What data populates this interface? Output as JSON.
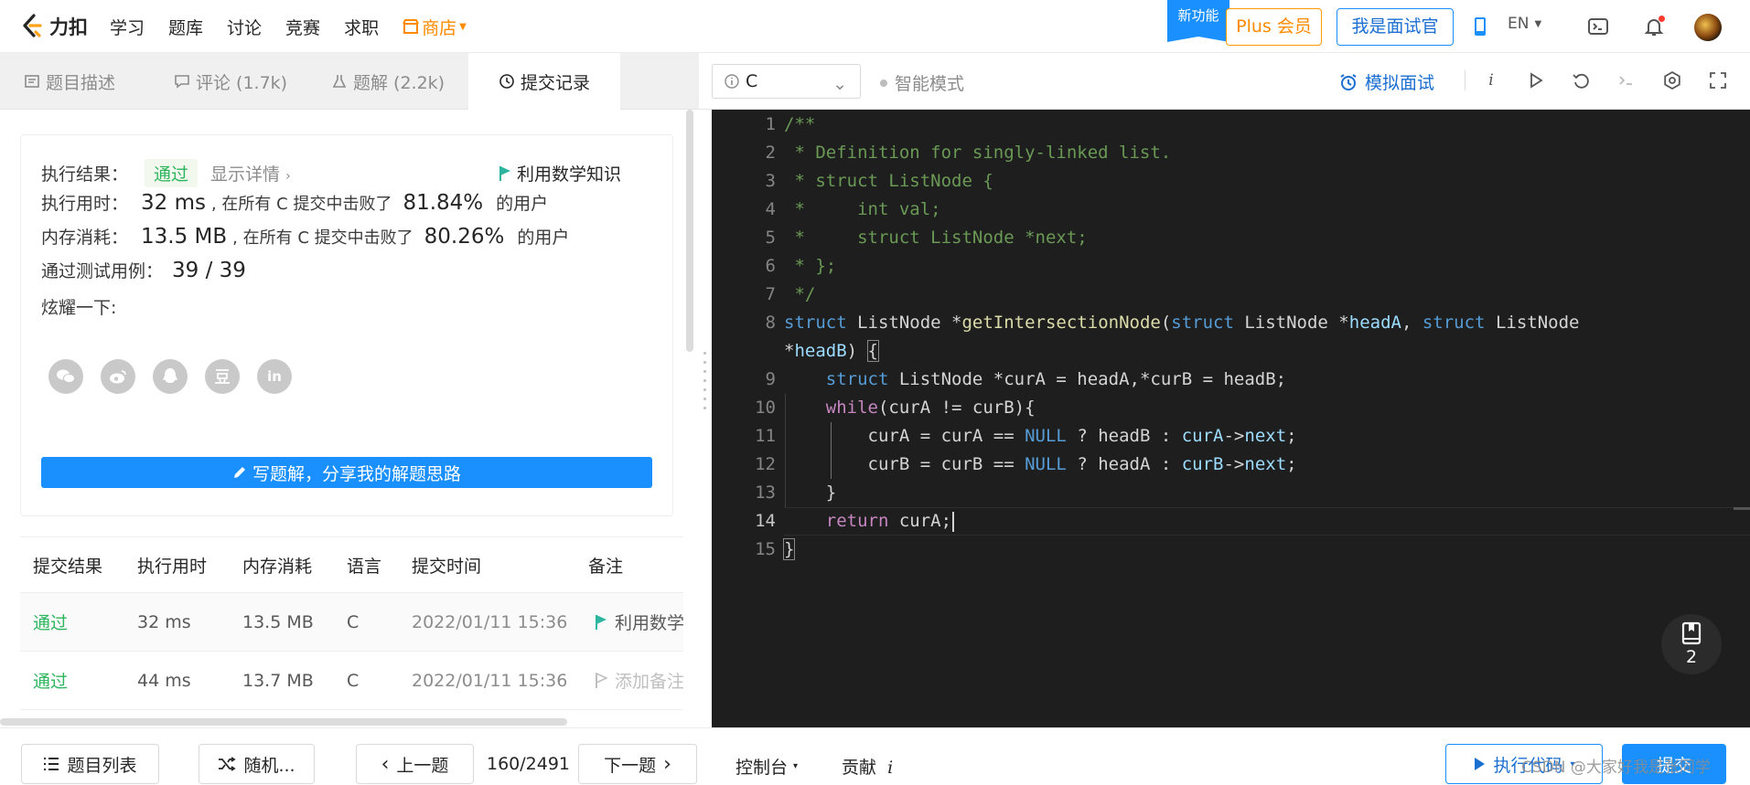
{
  "topnav": {
    "brand": "力扣",
    "links": [
      "学习",
      "题库",
      "讨论",
      "竞赛",
      "求职"
    ],
    "store": "商店",
    "new_feature": "新功能",
    "plus": "Plus 会员",
    "interviewer": "我是面试官",
    "lang": "EN"
  },
  "left_tabs": [
    {
      "label": "题目描述",
      "icon": "document-icon"
    },
    {
      "label": "评论 (1.7k)",
      "icon": "comment-icon"
    },
    {
      "label": "题解 (2.2k)",
      "icon": "flask-icon"
    },
    {
      "label": "提交记录",
      "icon": "clock-icon"
    }
  ],
  "result": {
    "result_label": "执行结果：",
    "result_value": "通过",
    "show_details": "显示详情",
    "note": "利用数学知识",
    "runtime_label": "执行用时：",
    "runtime_value": "32 ms",
    "runtime_mid": ", 在所有 C 提交中击败了",
    "runtime_pct": "81.84%",
    "runtime_tail": "的用户",
    "memory_label": "内存消耗：",
    "memory_value": "13.5 MB",
    "memory_mid": ", 在所有 C 提交中击败了",
    "memory_pct": "80.26%",
    "memory_tail": "的用户",
    "tests_label": "通过测试用例：",
    "tests_value": "39 / 39",
    "share_label": "炫耀一下:",
    "social": [
      "wechat-icon",
      "weibo-icon",
      "qq-icon",
      "douban-icon",
      "linkedin-icon"
    ],
    "write_solution": "写题解，分享我的解题思路"
  },
  "submissions": {
    "headers": [
      "提交结果",
      "执行用时",
      "内存消耗",
      "语言",
      "提交时间",
      "备注"
    ],
    "rows": [
      {
        "status": "通过",
        "runtime": "32 ms",
        "memory": "13.5 MB",
        "lang": "C",
        "time": "2022/01/11 15:36",
        "note": "利用数学"
      },
      {
        "status": "通过",
        "runtime": "44 ms",
        "memory": "13.7 MB",
        "lang": "C",
        "time": "2022/01/11 15:36",
        "note": "添加备注"
      }
    ]
  },
  "editor_bar": {
    "language": "C",
    "smart_mode": "智能模式",
    "mock_interview": "模拟面试"
  },
  "code": {
    "line_numbers": [
      "1",
      "2",
      "3",
      "4",
      "5",
      "6",
      "7",
      "8",
      "",
      "9",
      "10",
      "11",
      "12",
      "13",
      "14",
      "15"
    ],
    "current_line": "14",
    "lines": [
      "/**",
      " * Definition for singly-linked list.",
      " * struct ListNode {",
      " *     int val;",
      " *     struct ListNode *next;",
      " * };",
      " */",
      "struct ListNode *getIntersectionNode(struct ListNode *headA, struct ListNode",
      "*headB) {",
      "    struct ListNode *curA = headA,*curB = headB;",
      "    while(curA != curB){",
      "        curA = curA == NULL ? headB : curA->next;",
      "        curB = curB == NULL ? headA : curB->next;",
      "    }",
      "    return curA;",
      "}"
    ]
  },
  "notes_fab": {
    "count": "2"
  },
  "bottombar": {
    "problem_list": "题目列表",
    "random": "随机...",
    "prev": "上一题",
    "progress": "160/2491",
    "next": "下一题",
    "console": "控制台",
    "contribute": "贡献",
    "run": "执行代码",
    "submit": "提交",
    "watermark": "CSDN @大家好我是张同学"
  }
}
